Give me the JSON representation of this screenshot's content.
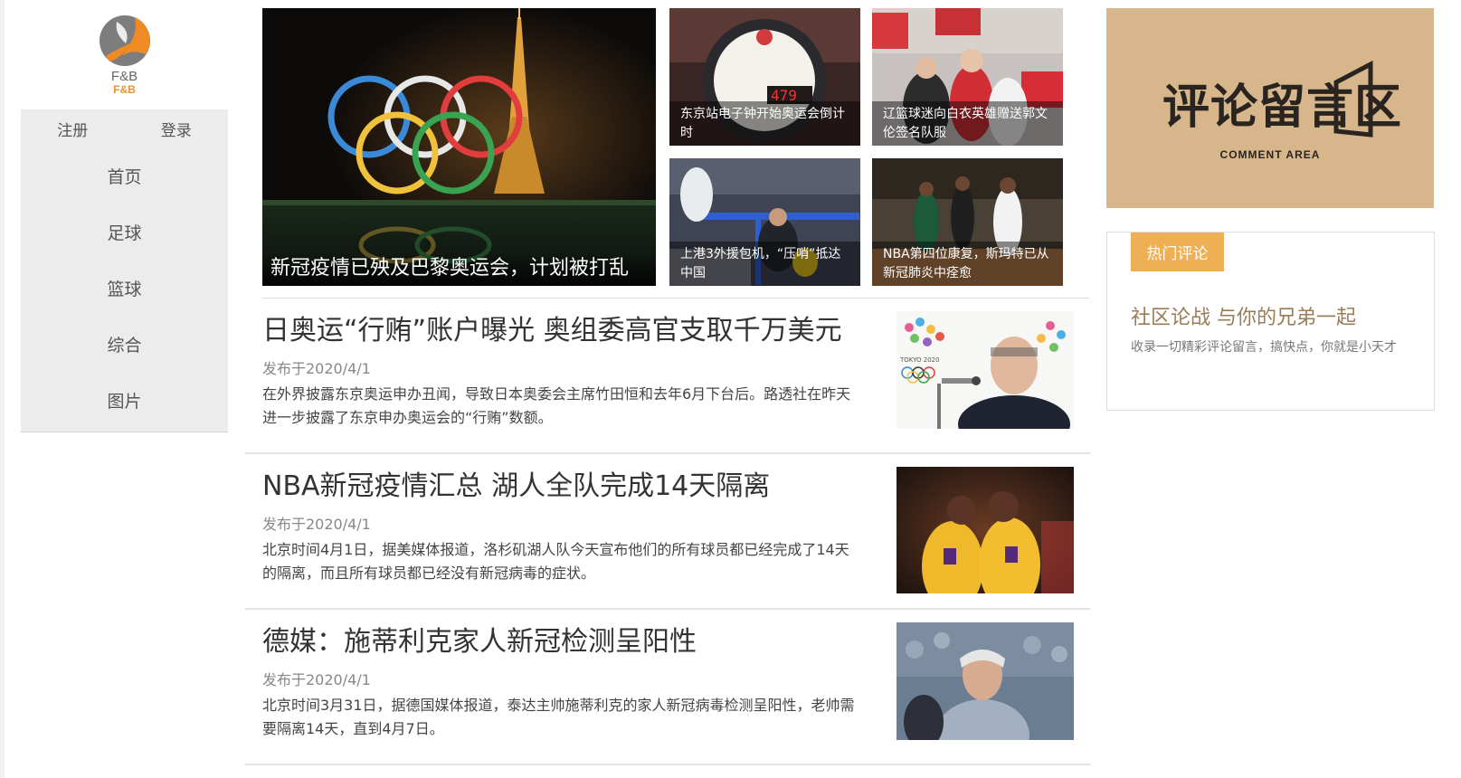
{
  "site": {
    "logo_text": "F&B",
    "logo_sub": "F&B"
  },
  "sidebar": {
    "register_label": "注册",
    "login_label": "登录",
    "items": [
      {
        "label": "首页"
      },
      {
        "label": "足球"
      },
      {
        "label": "篮球"
      },
      {
        "label": "综合"
      },
      {
        "label": "图片"
      }
    ]
  },
  "hero": {
    "main_caption": "新冠疫情已殃及巴黎奥运会，计划被打乱",
    "tiles": [
      {
        "caption": "东京站电子钟开始奥运会倒计时"
      },
      {
        "caption": "辽篮球迷向白衣英雄赠送郭文伦签名队服"
      },
      {
        "caption": "上港3外援包机，“压哨”抵达中国"
      },
      {
        "caption": "NBA第四位康复，斯玛特已从新冠肺炎中痊愈"
      }
    ],
    "countdown_digits": "479"
  },
  "articles": [
    {
      "title": "日奥运“行贿”账户曝光 奥组委高官支取千万美元",
      "date": "发布于2020/4/1",
      "summary": "在外界披露东京奥运申办丑闻，导致日本奥委会主席竹田恒和去年6月下台后。路透社在昨天进一步披露了东京申办奥运会的“行贿”数额。"
    },
    {
      "title": "NBA新冠疫情汇总 湖人全队完成14天隔离",
      "date": "发布于2020/4/1",
      "summary": "北京时间4月1日，据美媒体报道，洛杉矶湖人队今天宣布他们的所有球员都已经完成了14天的隔离，而且所有球员都已经没有新冠病毒的症状。"
    },
    {
      "title": "德媒：施蒂利克家人新冠检测呈阳性",
      "date": "发布于2020/4/1",
      "summary": "北京时间3月31日，据德国媒体报道，泰达主帅施蒂利克的家人新冠病毒检测呈阳性，老帅需要隔离14天，直到4月7日。"
    }
  ],
  "banner": {
    "title": "评论留言区",
    "subtitle": "COMMENT AREA"
  },
  "hot": {
    "tab_label": "热门评论",
    "title": "社区论战 与你的兄弟一起",
    "description": "收录一切精彩评论留言，搞快点，你就是小天才"
  },
  "colors": {
    "accent": "#efaf55",
    "banner_bg": "#d8b68b",
    "nav_bg": "#ececec"
  }
}
